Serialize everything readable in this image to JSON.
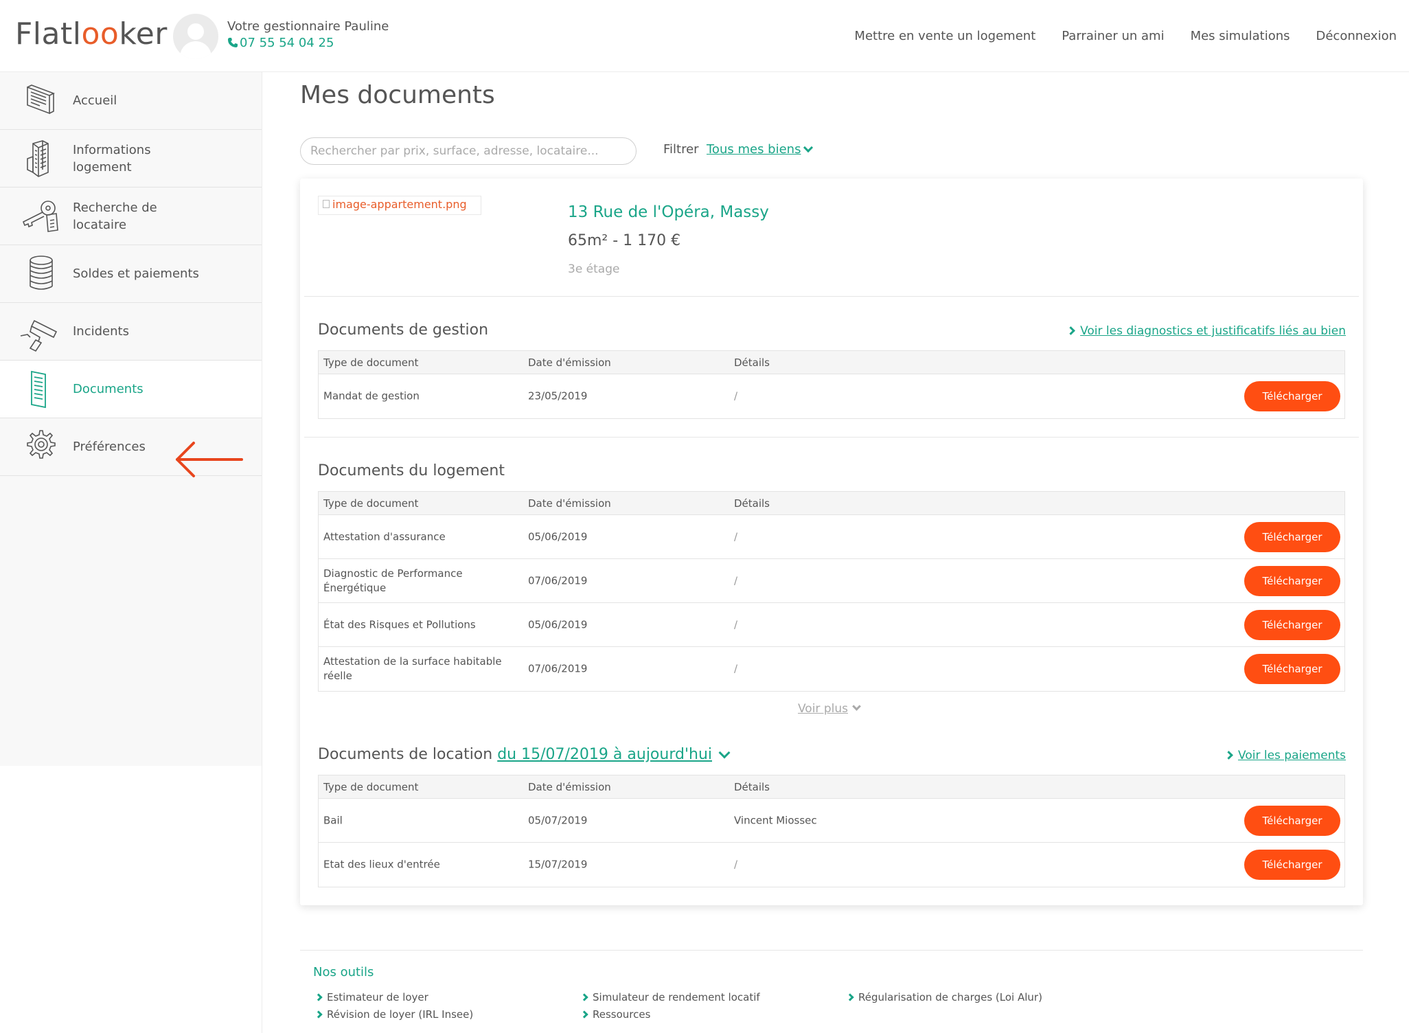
{
  "header": {
    "logo": {
      "part1": "Flatl",
      "part2": "oo",
      "part3": "ker"
    },
    "manager_name": "Votre gestionnaire Pauline",
    "manager_phone": "07 55 54 04 25",
    "nav": [
      "Mettre en vente un logement",
      "Parrainer un ami",
      "Mes simulations",
      "Déconnexion"
    ]
  },
  "sidebar": {
    "items": [
      {
        "label": "Accueil",
        "icon": "home-screen-icon"
      },
      {
        "label": "Informations logement",
        "icon": "building-icon"
      },
      {
        "label": "Recherche de locataire",
        "icon": "keys-icon"
      },
      {
        "label": "Soldes et paiements",
        "icon": "coins-icon"
      },
      {
        "label": "Incidents",
        "icon": "paint-roller-icon"
      },
      {
        "label": "Documents",
        "icon": "document-icon",
        "active": true
      },
      {
        "label": "Préférences",
        "icon": "gear-icon"
      }
    ]
  },
  "main": {
    "title": "Mes documents",
    "search_placeholder": "Rechercher par prix, surface, adresse, locataire...",
    "filter_label": "Filtrer",
    "filter_value": "Tous mes biens",
    "property": {
      "image_alt": "image-appartement.png",
      "address": "13 Rue de l'Opéra, Massy",
      "size_price": "65m² - 1 170 €",
      "floor": "3e étage"
    },
    "columns": {
      "type": "Type de document",
      "date": "Date d'émission",
      "details": "Détails"
    },
    "download_label": "Télécharger",
    "gestion": {
      "title": "Documents de gestion",
      "link": "Voir les diagnostics et justificatifs liés au bien",
      "rows": [
        {
          "type": "Mandat de gestion",
          "date": "23/05/2019",
          "details": "/"
        }
      ]
    },
    "logement": {
      "title": "Documents du logement",
      "rows": [
        {
          "type": "Attestation d'assurance",
          "date": "05/06/2019",
          "details": "/"
        },
        {
          "type": "Diagnostic de Performance Énergétique",
          "date": "07/06/2019",
          "details": "/"
        },
        {
          "type": "État des Risques et Pollutions",
          "date": "05/06/2019",
          "details": "/"
        },
        {
          "type": "Attestation de la surface habitable réelle",
          "date": "07/06/2019",
          "details": "/"
        }
      ],
      "more": "Voir plus"
    },
    "location": {
      "title": "Documents de location",
      "range": "du 15/07/2019 à aujourd'hui",
      "link": "Voir les paiements",
      "rows": [
        {
          "type": "Bail",
          "date": "05/07/2019",
          "details": "Vincent Miossec"
        },
        {
          "type": "Etat des lieux d'entrée",
          "date": "15/07/2019",
          "details": "/"
        }
      ]
    }
  },
  "footer": {
    "title": "Nos outils",
    "links": [
      "Estimateur de loyer",
      "Révision de loyer (IRL Insee)",
      "Simulateur de rendement locatif",
      "Ressources",
      "Régularisation de charges (Loi Alur)"
    ]
  },
  "colors": {
    "accent": "#1aa588",
    "button": "#ff4e12",
    "arrow": "#e8461e"
  }
}
